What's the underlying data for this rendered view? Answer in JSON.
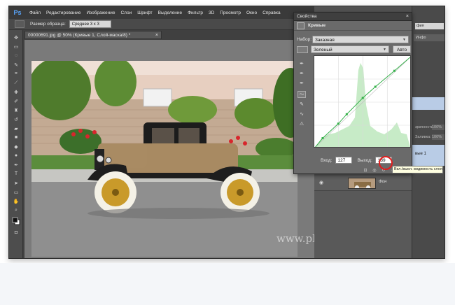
{
  "app": {
    "logo": "Ps"
  },
  "menu": [
    "Файл",
    "Редактирование",
    "Изображение",
    "Слои",
    "Шрифт",
    "Выделение",
    "Фильтр",
    "3D",
    "Просмотр",
    "Окно",
    "Справка"
  ],
  "options": {
    "sample_size_label": "Размер образца:",
    "sample_size_value": "Среднее 3 х 3"
  },
  "document": {
    "tab_title": "00000691.jpg @ 50% (Кривые 1, Слой-маска/8) *",
    "close": "×"
  },
  "watermark": "www.photoshopsunduchok.ru",
  "properties": {
    "title": "Свойства",
    "close": "×",
    "adjustment": "Кривые",
    "preset_label": "Набор:",
    "preset_value": "Заказная",
    "channel_value": "Зеленый",
    "auto_label": "Авто",
    "input_label": "Вход:",
    "input_value": "127",
    "output_label": "Выход:",
    "output_value": "139"
  },
  "right_strip": {
    "top_value": "фия",
    "tab": "Инфо",
    "opacity_label": "зрачность:",
    "opacity_value": "100%",
    "fill_label": "Заливка:",
    "fill_value": "100%",
    "layer_label": "вые 1"
  },
  "layers": {
    "background_name": "Фон"
  },
  "tooltip": "Вкл./выкл. видимость слоя",
  "colors": {
    "accent_green": "#35b04a",
    "highlight_red": "#e21d1d",
    "ps_blue": "#5aa7ff"
  },
  "curve_points": [
    {
      "input": 0,
      "output": 0
    },
    {
      "input": 22,
      "output": 28
    },
    {
      "input": 63,
      "output": 68
    },
    {
      "input": 85,
      "output": 94
    },
    {
      "input": 127,
      "output": 139
    },
    {
      "input": 160,
      "output": 170
    },
    {
      "input": 210,
      "output": 214
    },
    {
      "input": 255,
      "output": 255
    }
  ]
}
